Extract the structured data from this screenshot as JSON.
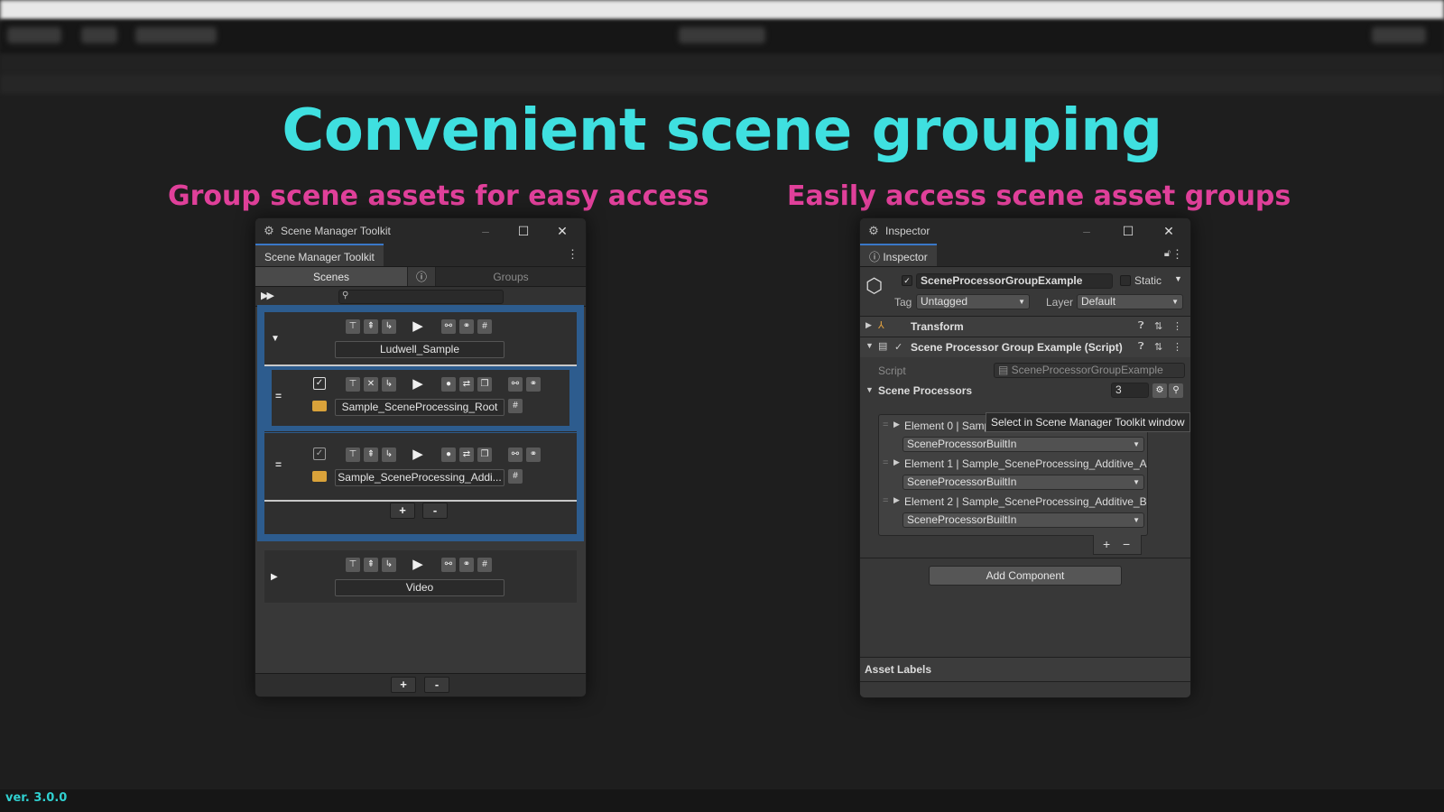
{
  "title": "Convenient scene grouping",
  "subtitle_left": "Group scene assets for easy access",
  "subtitle_right": "Easily access scene asset groups",
  "version": "ver. 3.0.0",
  "scene_manager": {
    "window_title": "Scene Manager Toolkit",
    "tab": "Scene Manager Toolkit",
    "tabs": [
      "Scenes",
      "Groups"
    ],
    "info_icon": "info-icon",
    "groups": [
      {
        "name": "Ludwell_Sample",
        "expanded": true,
        "scenes": [
          "Sample_SceneProcessing_Root",
          "Sample_SceneProcessing_Addi..."
        ]
      },
      {
        "name": "Video",
        "expanded": false,
        "scenes": []
      }
    ],
    "add_label": "+",
    "remove_label": "-"
  },
  "inspector": {
    "window_title": "Inspector",
    "tab": "Inspector",
    "object_name": "SceneProcessorGroupExample",
    "static_label": "Static",
    "tag_label": "Tag",
    "tag_value": "Untagged",
    "layer_label": "Layer",
    "layer_value": "Default",
    "transform_label": "Transform",
    "script_component_label": "Scene Processor Group Example (Script)",
    "script_label": "Script",
    "script_value": "SceneProcessorGroupExample",
    "processors_label": "Scene Processors",
    "processors_count": "3",
    "elements": [
      {
        "label": "Element 0 | Samp",
        "value": "SceneProcessorBuiltIn"
      },
      {
        "label": "Element 1 | Sample_SceneProcessing_Additive_A",
        "value": "SceneProcessorBuiltIn"
      },
      {
        "label": "Element 2 | Sample_SceneProcessing_Additive_B",
        "value": "SceneProcessorBuiltIn"
      }
    ],
    "tooltip": "Select in Scene Manager Toolkit window",
    "add_component": "Add Component",
    "asset_labels": "Asset Labels",
    "add_label": "+",
    "remove_label": "−"
  },
  "colors": {
    "title": "#3fe0e0",
    "subtitle": "#e0409a",
    "selection": "#2d5c8e",
    "version": "#30d0d0"
  }
}
